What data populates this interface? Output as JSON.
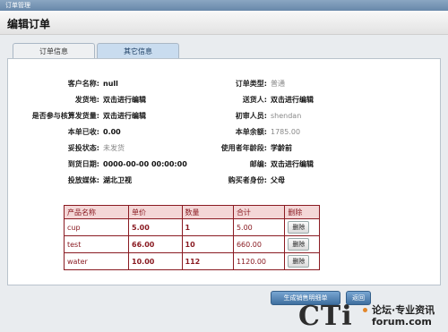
{
  "window": {
    "title": "订单管理"
  },
  "header": {
    "title": "编辑订单"
  },
  "tabs": [
    {
      "label": "订单信息",
      "active": false
    },
    {
      "label": "其它信息",
      "active": true
    }
  ],
  "fields": {
    "customer_name": {
      "label": "客户名称:",
      "value": "null"
    },
    "order_type": {
      "label": "订单类型:",
      "value": "普通"
    },
    "ship_from": {
      "label": "发货地:",
      "value": "双击进行编辑"
    },
    "deliverer": {
      "label": "送货人:",
      "value": "双击进行编辑"
    },
    "verify_qty": {
      "label": "是否参与核算发货量:",
      "value": "双击进行编辑"
    },
    "reviewer": {
      "label": "初审人员:",
      "value": "shendan"
    },
    "received": {
      "label": "本单已收:",
      "value": "0.00"
    },
    "balance": {
      "label": "本单余额:",
      "value": "1785.00"
    },
    "delivery_status": {
      "label": "妥投状态:",
      "value": "未发货"
    },
    "user_age": {
      "label": "使用者年龄段:",
      "value": "学龄前"
    },
    "arrival_date": {
      "label": "到货日期:",
      "value": "0000-00-00 00:00:00"
    },
    "postcode": {
      "label": "邮编:",
      "value": "双击进行编辑"
    },
    "media": {
      "label": "投放媒体:",
      "value": "湖北卫视"
    },
    "buyer_identity": {
      "label": "购买者身份:",
      "value": "父母"
    }
  },
  "table": {
    "headers": [
      "产品名称",
      "单价",
      "数量",
      "合计",
      "删除"
    ],
    "rows": [
      {
        "name": "cup",
        "price": "5.00",
        "qty": "1",
        "total": "5.00",
        "action": "删除"
      },
      {
        "name": "test",
        "price": "66.00",
        "qty": "10",
        "total": "660.00",
        "action": "删除"
      },
      {
        "name": "water",
        "price": "10.00",
        "qty": "112",
        "total": "1120.00",
        "action": "删除"
      }
    ]
  },
  "buttons": {
    "generate": "生成销售明细单",
    "back": "返回"
  },
  "watermark": {
    "logo": "CTi",
    "line1": "论坛·专业资讯",
    "line2": "forum.com"
  }
}
